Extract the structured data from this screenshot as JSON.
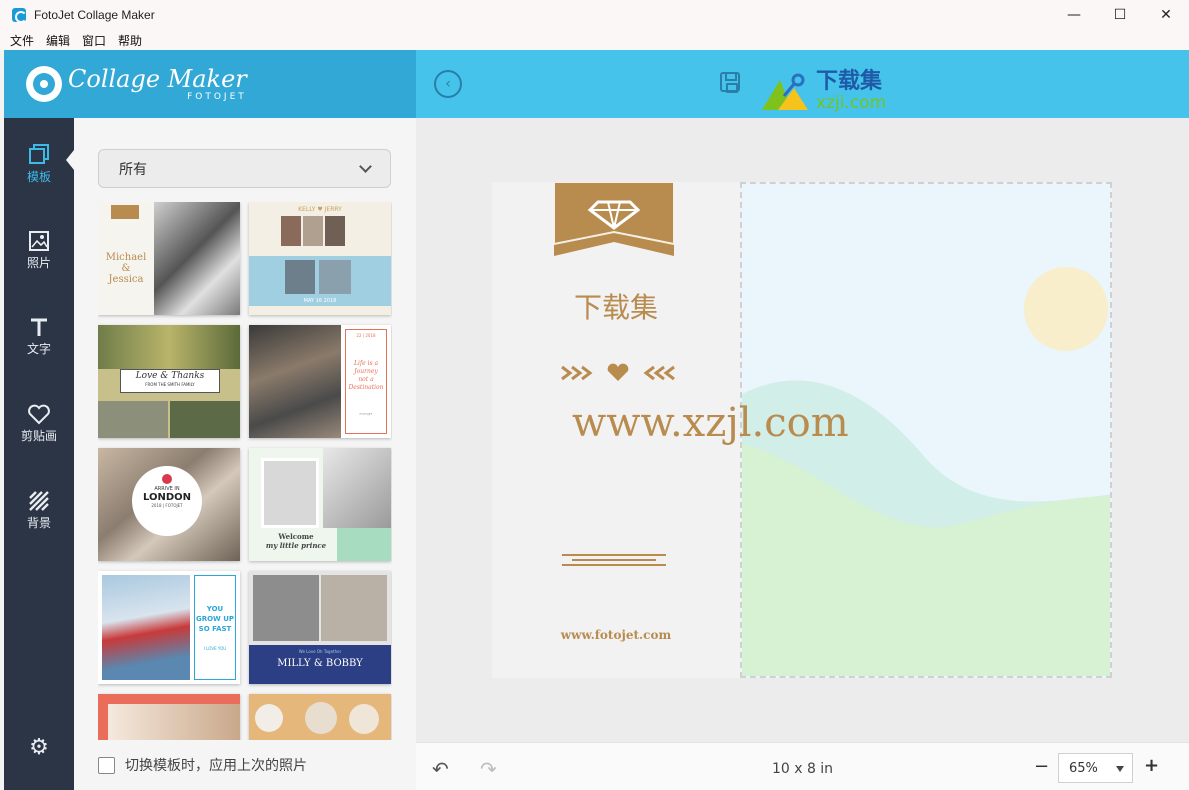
{
  "window": {
    "title": "FotoJet Collage Maker",
    "controls": [
      "—",
      "☐",
      "✕"
    ]
  },
  "menu": [
    "文件",
    "编辑",
    "窗口",
    "帮助"
  ],
  "logo": {
    "main": "Collage Maker",
    "sub": "FOTOJET"
  },
  "watermark": {
    "cn": "下载集",
    "url": "xzji.com"
  },
  "rail": [
    {
      "label": "模板",
      "icon": "template-icon",
      "active": true
    },
    {
      "label": "照片",
      "icon": "photo-icon"
    },
    {
      "label": "文字",
      "icon": "text-icon"
    },
    {
      "label": "剪贴画",
      "icon": "clipart-icon"
    },
    {
      "label": "背景",
      "icon": "background-icon"
    }
  ],
  "panel": {
    "dropdown_value": "所有",
    "footer_label": "切换模板时，应用上次的照片"
  },
  "thumbs": {
    "t1": {
      "line1": "Michael",
      "line2": "&",
      "line3": "Jessica"
    },
    "t2": {
      "header": "KELLY ♥ JERRY",
      "date": "MAY 16 2018"
    },
    "t3": {
      "title": "Love & Thanks",
      "sub": "FROM THE SMITH FAMILY"
    },
    "t4": {
      "date": "22 | 2018",
      "text1": "Life is a",
      "text2": "Journey",
      "text3": "not a",
      "text4": "Destination",
      "brand": "FOTOJET"
    },
    "t5": {
      "line1": "ARRIVE IN",
      "line2": "LONDON",
      "line3": "2018 | FOTOJET"
    },
    "t6": {
      "line1": "Welcome",
      "line2": "my little prince"
    },
    "t7": {
      "line1": "YOU",
      "line2": "GROW UP",
      "line3": "SO FAST",
      "line4": "I LOVE YOU"
    },
    "t8": {
      "sub": "We Love Oh Together",
      "title": "MILLY & BOBBY"
    }
  },
  "canvas": {
    "title": "下载集",
    "url": "www.xzjl.com",
    "site": "www.fotojet.com"
  },
  "bottombar": {
    "size": "10 x 8 in",
    "zoom": "65%",
    "minus": "−",
    "plus": "+"
  },
  "colors": {
    "header_left": "#31a8d6",
    "header_right": "#45c3ea",
    "rail": "#2c3545",
    "accent": "#3cbbe8",
    "gold": "#b88b4e"
  }
}
